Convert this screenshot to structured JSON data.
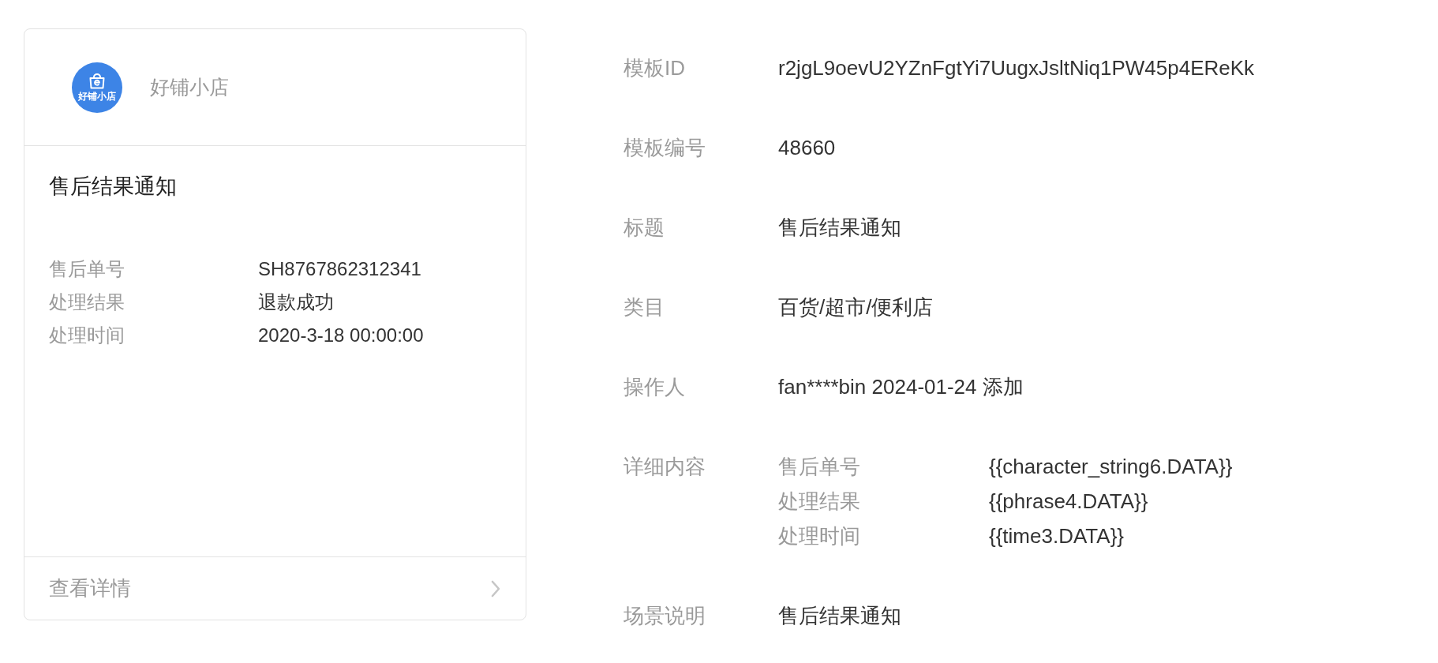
{
  "preview_card": {
    "shop": {
      "logo_text": "好铺小店",
      "name": "好铺小店"
    },
    "title": "售后结果通知",
    "fields": [
      {
        "label": "售后单号",
        "value": "SH8767862312341"
      },
      {
        "label": "处理结果",
        "value": "退款成功"
      },
      {
        "label": "处理时间",
        "value": "2020-3-18 00:00:00"
      }
    ],
    "footer_link": "查看详情"
  },
  "details": [
    {
      "kind": "text",
      "label": "模板ID",
      "value": "r2jgL9oevU2YZnFgtYi7UugxJsltNiq1PW45p4EReKk"
    },
    {
      "kind": "text",
      "label": "模板编号",
      "value": "48660"
    },
    {
      "kind": "text",
      "label": "标题",
      "value": "售后结果通知"
    },
    {
      "kind": "text",
      "label": "类目",
      "value": "百货/超市/便利店"
    },
    {
      "kind": "text",
      "label": "操作人",
      "value": "fan****bin 2024-01-24 添加"
    },
    {
      "kind": "fields",
      "label": "详细内容",
      "fields": [
        {
          "label": "售后单号",
          "value": "{{character_string6.DATA}}"
        },
        {
          "label": "处理结果",
          "value": "{{phrase4.DATA}}"
        },
        {
          "label": "处理时间",
          "value": "{{time3.DATA}}"
        }
      ]
    },
    {
      "kind": "text",
      "label": "场景说明",
      "value": "售后结果通知"
    }
  ]
}
